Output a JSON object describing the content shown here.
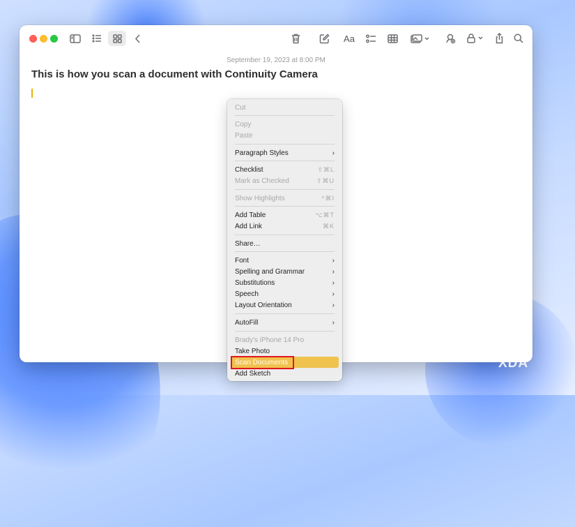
{
  "note": {
    "date": "September 19, 2023 at 8:00 PM",
    "title": "This is how you scan a document with Continuity Camera"
  },
  "toolbar": {
    "icons": [
      "sidebar-icon",
      "list-view-icon",
      "gallery-view-icon",
      "back-icon",
      "trash-icon",
      "compose-icon",
      "format-text-icon",
      "checklist-icon",
      "table-icon",
      "media-icon",
      "collaborate-icon",
      "lock-icon",
      "share-icon",
      "search-icon"
    ],
    "format_label": "Aa"
  },
  "menu": {
    "cut": "Cut",
    "copy": "Copy",
    "paste": "Paste",
    "paragraph_styles": "Paragraph Styles",
    "checklist": "Checklist",
    "checklist_sc": "⇧⌘L",
    "mark_checked": "Mark as Checked",
    "mark_checked_sc": "⇧⌘U",
    "show_highlights": "Show Highlights",
    "show_highlights_sc": "^⌘I",
    "add_table": "Add Table",
    "add_table_sc": "⌥⌘T",
    "add_link": "Add Link",
    "add_link_sc": "⌘K",
    "share": "Share…",
    "font": "Font",
    "spelling": "Spelling and Grammar",
    "substitutions": "Substitutions",
    "speech": "Speech",
    "layout_orientation": "Layout Orientation",
    "autofill": "AutoFill",
    "device": "Brady's iPhone 14 Pro",
    "take_photo": "Take Photo",
    "scan_documents": "Scan Documents",
    "add_sketch": "Add Sketch",
    "chevron": "›"
  },
  "watermark": {
    "text": "XDA"
  },
  "colors": {
    "highlight": "#f0c24e",
    "annotation_box": "#e0171d",
    "caret": "#e7b400"
  }
}
